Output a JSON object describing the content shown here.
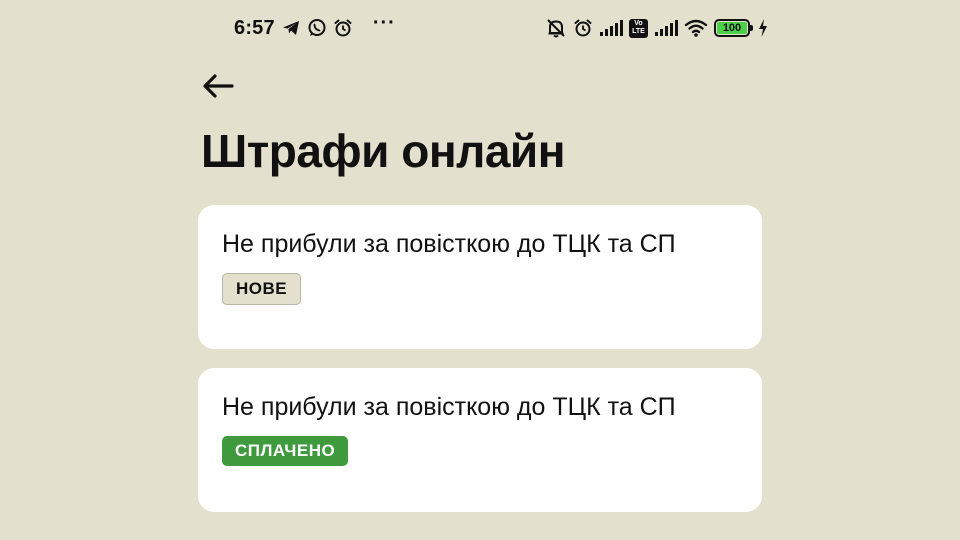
{
  "status_bar": {
    "time": "6:57",
    "left_icons": [
      "telegram-icon",
      "whatsapp-icon",
      "alarm-icon"
    ],
    "more": "···",
    "right_icons": [
      "mute-icon",
      "alarm-icon",
      "signal-icon",
      "volte-icon",
      "signal-icon",
      "wifi-icon",
      "battery-icon",
      "charging-icon"
    ],
    "volte_line1": "Vo",
    "volte_line2": "LTE",
    "battery_level": "100"
  },
  "header": {
    "back_icon": "arrow-left-icon",
    "title": "Штрафи онлайн"
  },
  "fines": [
    {
      "title": "Не прибули за повісткою до ТЦК та СП",
      "status": "НОВЕ",
      "status_color": "#e3e0cd"
    },
    {
      "title": "Не прибули за повісткою до ТЦК та СП",
      "status": "СПЛАЧЕНО",
      "status_color": "#3f9a3e"
    }
  ],
  "colors": {
    "background": "#e3e0cd",
    "card": "#ffffff",
    "paid_badge": "#3f9a3e",
    "battery": "#4cd04a"
  }
}
